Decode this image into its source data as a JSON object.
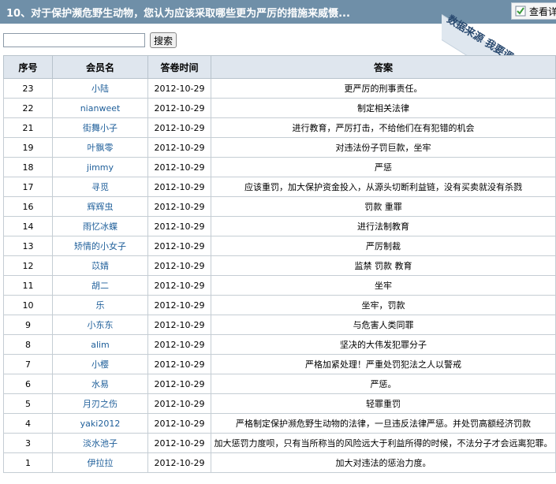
{
  "header": {
    "title": "10、对于保护濒危野生动物，您认为应该采取哪些更为严厉的措施来威慑...",
    "ribbon_text": "数据来源 我要调查网",
    "view_label": "查看详"
  },
  "search": {
    "placeholder": "",
    "button_label": "搜索"
  },
  "table": {
    "columns": [
      "序号",
      "会员名",
      "答卷时间",
      "答案"
    ],
    "rows": [
      {
        "id": "23",
        "member": "小陆",
        "time": "2012-10-29",
        "answer": "更严厉的刑事责任。"
      },
      {
        "id": "22",
        "member": "nianweet",
        "time": "2012-10-29",
        "answer": "制定相关法律"
      },
      {
        "id": "21",
        "member": "街舞小子",
        "time": "2012-10-29",
        "answer": "进行教育，严厉打击，不给他们在有犯错的机会"
      },
      {
        "id": "19",
        "member": "叶飘零",
        "time": "2012-10-29",
        "answer": "对违法份子罚巨款，坐牢"
      },
      {
        "id": "18",
        "member": "jimmy",
        "time": "2012-10-29",
        "answer": "严惩"
      },
      {
        "id": "17",
        "member": "寻觅",
        "time": "2012-10-29",
        "answer": "应该重罚，加大保护资金投入，从源头切断利益链，没有买卖就没有杀戮"
      },
      {
        "id": "16",
        "member": "辉辉虫",
        "time": "2012-10-29",
        "answer": "罚款 重罪"
      },
      {
        "id": "14",
        "member": "雨忆冰蝶",
        "time": "2012-10-29",
        "answer": "进行法制教育"
      },
      {
        "id": "13",
        "member": "矫情的小女子",
        "time": "2012-10-29",
        "answer": "严厉制裁"
      },
      {
        "id": "12",
        "member": "苡婧",
        "time": "2012-10-29",
        "answer": "监禁 罚款 教育"
      },
      {
        "id": "11",
        "member": "胡二",
        "time": "2012-10-29",
        "answer": "坐牢"
      },
      {
        "id": "10",
        "member": "乐",
        "time": "2012-10-29",
        "answer": "坐牢，罚款"
      },
      {
        "id": "9",
        "member": "小东东",
        "time": "2012-10-29",
        "answer": "与危害人类同罪"
      },
      {
        "id": "8",
        "member": "alim",
        "time": "2012-10-29",
        "answer": "坚决的大伟发犯罪分子"
      },
      {
        "id": "7",
        "member": "小樱",
        "time": "2012-10-29",
        "answer": "严格加紧处理！严重处罚犯法之人以警戒"
      },
      {
        "id": "6",
        "member": "水易",
        "time": "2012-10-29",
        "answer": "严惩。"
      },
      {
        "id": "5",
        "member": "月刃之伤",
        "time": "2012-10-29",
        "answer": "轻罪重罚"
      },
      {
        "id": "4",
        "member": "yaki2012",
        "time": "2012-10-29",
        "answer": "严格制定保护濒危野生动物的法律，一旦违反法律严惩。并处罚高额经济罚款"
      },
      {
        "id": "3",
        "member": "淡水池子",
        "time": "2012-10-29",
        "answer": "加大惩罚力度呗，只有当所称当的风险远大于利益所得的时候，不法分子才会远离犯罪。"
      },
      {
        "id": "1",
        "member": "伊拉拉",
        "time": "2012-10-29",
        "answer": "加大对违法的惩治力度。"
      }
    ]
  },
  "colors": {
    "header_bg": "#6f8fa8",
    "table_header_bg": "#dfe6ee",
    "member_link": "#1f5f9a"
  }
}
